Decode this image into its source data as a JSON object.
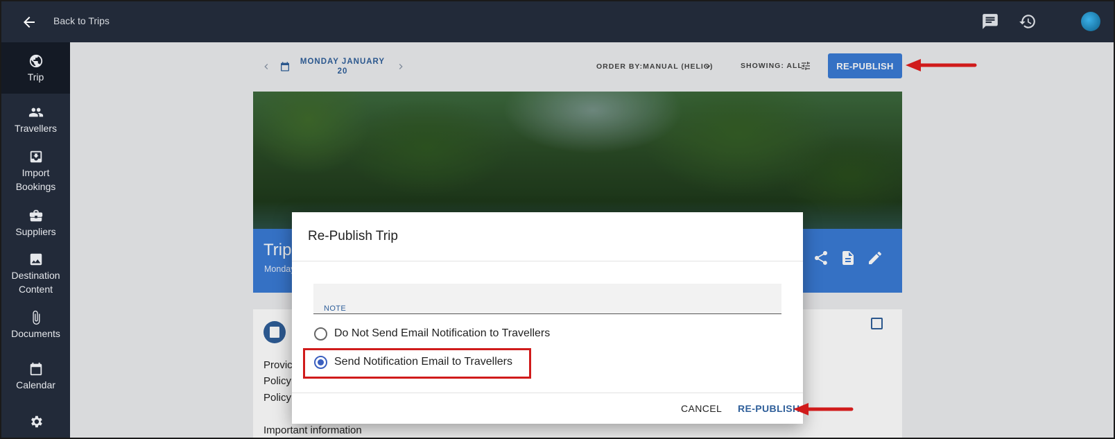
{
  "topbar": {
    "back_label": "Back to Trips",
    "icons": [
      "back-arrow-icon",
      "chat-icon",
      "history-icon",
      "avatar"
    ]
  },
  "sidebar": {
    "items": [
      {
        "label": "Trip",
        "icon": "globe-icon",
        "active": true
      },
      {
        "label": "Travellers",
        "icon": "people-icon"
      },
      {
        "label": "Import Bookings",
        "icon": "import-icon"
      },
      {
        "label": "Suppliers",
        "icon": "briefcase-icon"
      },
      {
        "label": "Destination Content",
        "icon": "image-icon"
      },
      {
        "label": "Documents",
        "icon": "paperclip-icon"
      },
      {
        "label": "Calendar",
        "icon": "calendar-icon"
      },
      {
        "label": "",
        "icon": "gear-icon"
      }
    ]
  },
  "toolbar": {
    "date_line1": "MONDAY JANUARY",
    "date_line2": "20",
    "order_by": "ORDER BY:MANUAL (HELIO)",
    "showing": "SHOWING: ALL",
    "republish_label": "RE-PUBLISH"
  },
  "trip_card": {
    "title": "Trip",
    "subtitle": "Monday"
  },
  "content": {
    "lines": [
      "Provic",
      "Policy",
      "Policy",
      "Important information"
    ]
  },
  "dialog": {
    "title": "Re-Publish Trip",
    "note_label": "NOTE",
    "note_value": "",
    "options": [
      {
        "label": "Do Not Send Email Notification to Travellers",
        "checked": false
      },
      {
        "label": "Send Notification Email to Travellers",
        "checked": true
      }
    ],
    "cancel_label": "CANCEL",
    "republish_label": "RE-PUBLISH"
  },
  "colors": {
    "sidebar_bg": "#222a39",
    "accent": "#3a7bd5",
    "highlight": "#d01b1b"
  }
}
